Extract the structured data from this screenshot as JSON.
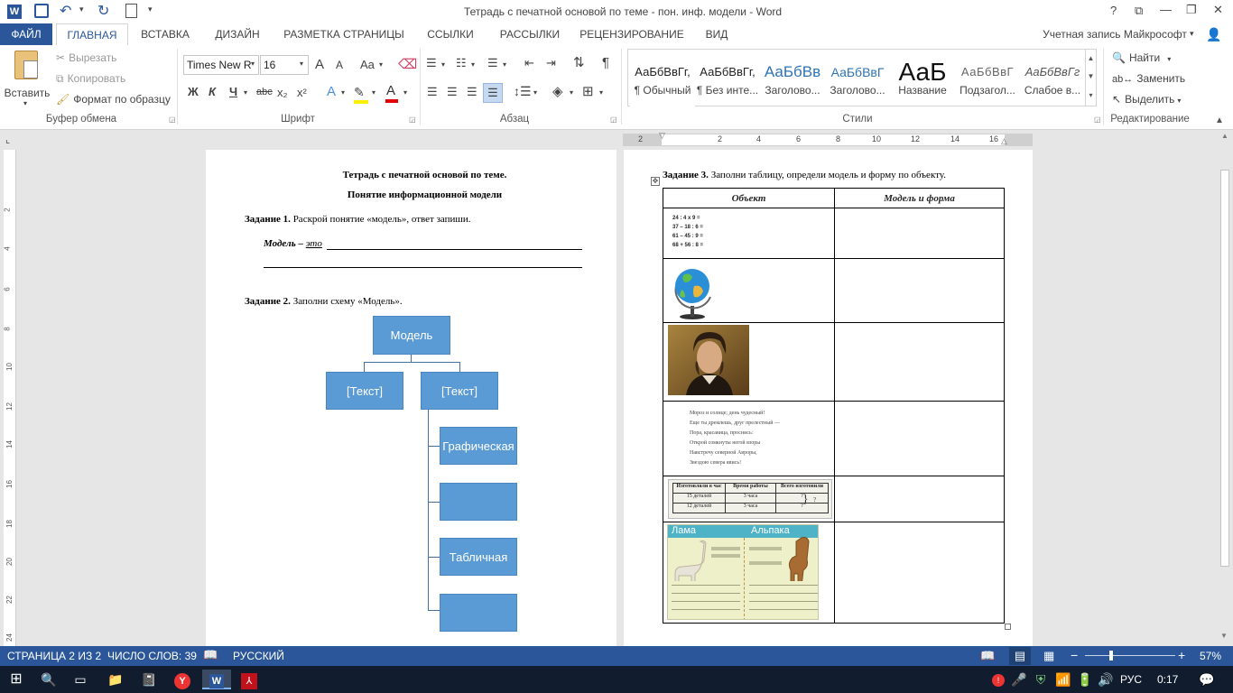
{
  "window": {
    "title": "Тетрадь с печатной основой по теме - пон. инф. модели - Word",
    "controls": [
      "?",
      "⧉",
      "—",
      "❐",
      "✕"
    ]
  },
  "tabs": {
    "file": "ФАЙЛ",
    "items": [
      "ГЛАВНАЯ",
      "ВСТАВКА",
      "ДИЗАЙН",
      "РАЗМЕТКА СТРАНИЦЫ",
      "ССЫЛКИ",
      "РАССЫЛКИ",
      "РЕЦЕНЗИРОВАНИЕ",
      "ВИД"
    ],
    "active": "ГЛАВНАЯ",
    "account": "Учетная запись Майкрософт"
  },
  "ribbon": {
    "clipboard": {
      "paste": "Вставить",
      "cut": "Вырезать",
      "copy": "Копировать",
      "format_painter": "Формат по образцу",
      "label": "Буфер обмена"
    },
    "font": {
      "font_name": "Times New R",
      "font_size": "16",
      "label": "Шрифт",
      "bold": "Ж",
      "italic": "К",
      "underline": "Ч",
      "strike": "abc",
      "subscript": "x₂",
      "superscript": "x²",
      "grow": "A",
      "shrink": "A",
      "case": "Aa",
      "font_color": "A",
      "effects": "A"
    },
    "paragraph": {
      "label": "Абзац"
    },
    "styles": {
      "label": "Стили",
      "items": [
        {
          "sample": "АаБбВвГг,",
          "name": "¶ Обычный"
        },
        {
          "sample": "АаБбВвГг,",
          "name": "¶ Без инте..."
        },
        {
          "sample": "АаБбВв",
          "name": "Заголово..."
        },
        {
          "sample": "АаБбВвГ",
          "name": "Заголово..."
        },
        {
          "sample": "АаБ",
          "name": "Название"
        },
        {
          "sample": "АаБбВвГ",
          "name": "Подзагол..."
        },
        {
          "sample": "АаБбВвГг",
          "name": "Слабое в..."
        }
      ]
    },
    "editing": {
      "label": "Редактирование",
      "find": "Найти",
      "replace": "Заменить",
      "select": "Выделить"
    }
  },
  "ruler": {
    "horizontal": [
      "2",
      "2",
      "4",
      "6",
      "8",
      "10",
      "12",
      "14",
      "16"
    ],
    "vertical": [
      "2",
      "4",
      "6",
      "8",
      "10",
      "12",
      "14",
      "16",
      "18",
      "20",
      "22",
      "24"
    ]
  },
  "page_left": {
    "title1": "Тетрадь с печатной основой по теме.",
    "title2": "Понятие информационной модели",
    "task1_label": "Задание 1.",
    "task1_text": " Раскрой понятие «модель», ответ запиши.",
    "model_is": "Модель – ",
    "model_is_u": "это",
    "task2_label": "Задание 2.",
    "task2_text": " Заполни схему «Модель».",
    "diagram": {
      "root": "Модель",
      "child1": "[Текст]",
      "child2": "[Текст]",
      "sub1": "Графическая",
      "sub2": "",
      "sub3": "Табличная",
      "sub4": ""
    }
  },
  "page_right": {
    "task3_label": "Задание 3.",
    "task3_text": " Заполни таблицу, определи модель и форму по объекту.",
    "col1": "Объект",
    "col2": "Модель и форма",
    "math": [
      "24 : 4 x 9 =",
      "37 – 18 : 6 =",
      "61 – 45 : 9 =",
      "68 + 56 : 8 ="
    ],
    "poem": [
      "Мороз и солнце; день чудесный!",
      "Еще ты дремлешь, друг прелестный —",
      "Пора, красавица, проснись:",
      "Открой сомкнуты негой взоры",
      "Навстречу северной Авроры,",
      "Звездою севера явись!"
    ],
    "mini_table": {
      "headers": [
        "Изготовляли в час",
        "Время работы",
        "Всего изготовили"
      ],
      "rows": [
        [
          "15 деталей",
          "3 часа",
          "?"
        ],
        [
          "12 деталей",
          "3 часа",
          "?"
        ]
      ],
      "mark": "?"
    },
    "llama": {
      "left": "Лама",
      "right": "Альпака"
    }
  },
  "status": {
    "page": "СТРАНИЦА 2 ИЗ 2",
    "words": "ЧИСЛО СЛОВ: 39",
    "lang": "РУССКИЙ",
    "zoom": "57%"
  },
  "taskbar": {
    "lang": "РУС",
    "time": "0:17"
  },
  "colors": {
    "accent": "#2b579a",
    "diagram_fill": "#5b9bd5",
    "taskbar": "#111d2e"
  }
}
